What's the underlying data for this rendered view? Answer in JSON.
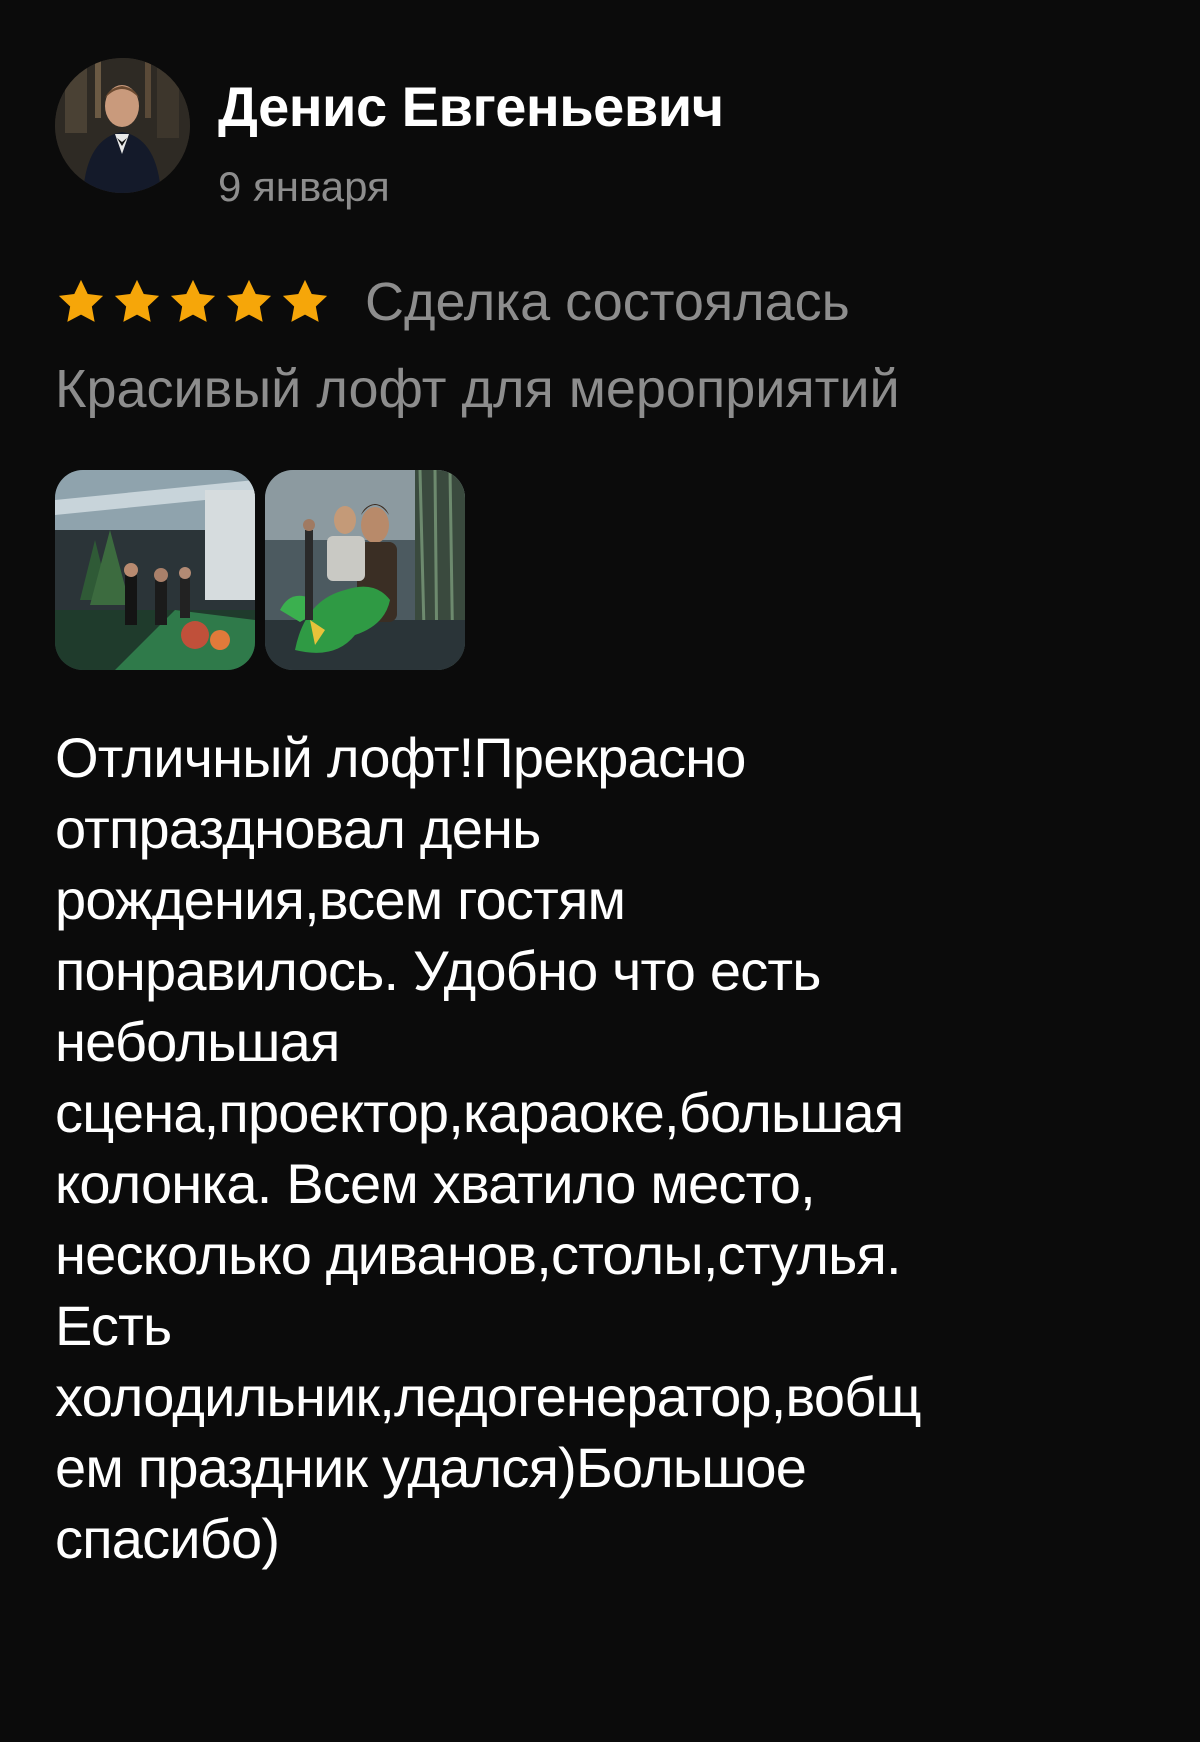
{
  "review": {
    "author": {
      "name": "Денис Евгеньевич",
      "avatar_icon": "user-avatar-photo"
    },
    "date": "9 января",
    "rating": 5,
    "rating_max": 5,
    "star_color": "#f6a609",
    "deal_status": "Сделка состоялась",
    "listing_title": "Красивый лофт для мероприятий",
    "photos": [
      {
        "icon": "loft-party-photo"
      },
      {
        "icon": "party-guests-photo"
      }
    ],
    "text_lines": [
      "Отличный лофт!Прекрасно",
      "отпраздновал день",
      "рождения,всем гостям",
      "понравилось. Удобно что есть",
      "небольшая",
      "сцена,проектор,караоке,большая",
      "колонка. Всем хватило место,",
      "несколько диванов,столы,стулья.",
      "Есть",
      "холодильник,ледогенератор,вобщ",
      "ем праздник удался)Большое",
      "спасибо)"
    ]
  },
  "colors": {
    "background": "#0b0b0b",
    "primary_text": "#ffffff",
    "secondary_text": "#8d8d8d",
    "star": "#f6a609"
  }
}
